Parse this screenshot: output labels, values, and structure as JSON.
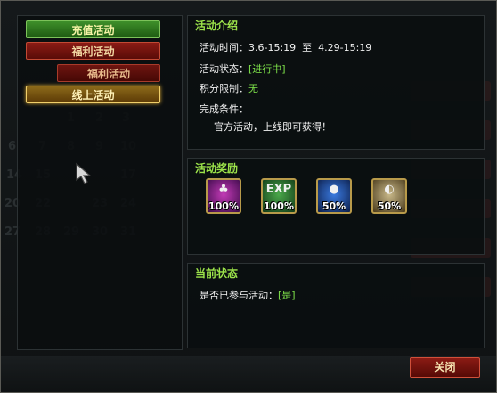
{
  "menu": {
    "recharge": "充值活动",
    "welfare": "福利活动",
    "welfare_sub": "福利活动",
    "online": "线上活动"
  },
  "intro": {
    "title": "活动介绍",
    "time_label": "活动时间：",
    "time_value": "3.6-15:19  至  4.29-15:19",
    "status_label": "活动状态：",
    "status_value": "[进行中]",
    "points_label": "积分限制：",
    "points_value": "无",
    "condition_label": "完成条件：",
    "condition_value": "官方活动，上线即可获得！"
  },
  "rewards": {
    "title": "活动奖励",
    "items": [
      {
        "icon": "potion-icon",
        "glyph": "♣",
        "percent": "100%"
      },
      {
        "icon": "exp-icon",
        "glyph": "EXP",
        "percent": "100%"
      },
      {
        "icon": "blue-potion-icon",
        "glyph": "●",
        "percent": "50%"
      },
      {
        "icon": "scroll-icon",
        "glyph": "◐",
        "percent": "50%"
      }
    ]
  },
  "current": {
    "title": "当前状态",
    "joined_label": "是否已参与活动：",
    "joined_value": "[是]"
  },
  "close_label": "关闭",
  "colors": {
    "accent_green": "#9ce34a",
    "value_green": "#7ee24a",
    "button_red": "#8a1b14",
    "button_gold": "#8c6a1a"
  }
}
